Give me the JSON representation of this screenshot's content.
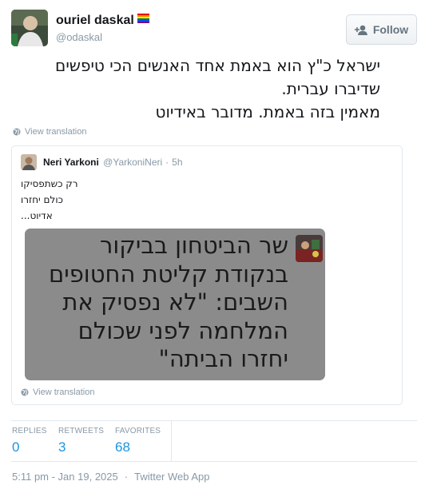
{
  "author": {
    "name": "ouriel daskal",
    "handle": "@odaskal",
    "follow_label": "Follow"
  },
  "tweet": {
    "text_lines": [
      "ישראל כ\"ץ הוא באמת אחד האנשים הכי טיפשים",
      "שדיברו עברית.",
      "מאמין בזה באמת. מדובר באידיוט"
    ],
    "view_translation": "View translation"
  },
  "quoted": {
    "name": "Neri Yarkoni",
    "handle": "@YarkoniNeri",
    "separator": "·",
    "time": "5h",
    "lines": [
      "רק כשתפסיקו",
      "כולם יחזרו",
      "אדיוט..."
    ],
    "image_text_lines": [
      "שר הביטחון בביקור",
      "בנקודת קליטת החטופים",
      "השבים: \"לא נפסיק את",
      "המלחמה לפני שכולם",
      "יחזרו הביתה\""
    ],
    "view_translation": "View translation"
  },
  "stats": {
    "replies_label": "REPLIES",
    "replies": "0",
    "retweets_label": "RETWEETS",
    "retweets": "3",
    "favorites_label": "FAVORITES",
    "favorites": "68"
  },
  "footer": {
    "timestamp": "5:11 pm - Jan 19, 2025",
    "separator": "·",
    "source": "Twitter Web App"
  },
  "colors": {
    "link": "#1b95e0",
    "muted": "#8899a6",
    "border": "#e1e8ed",
    "image_bg": "#8b8b8b"
  },
  "icons": [
    "rainbow-flag-icon",
    "follow-user-icon",
    "globe-icon"
  ]
}
